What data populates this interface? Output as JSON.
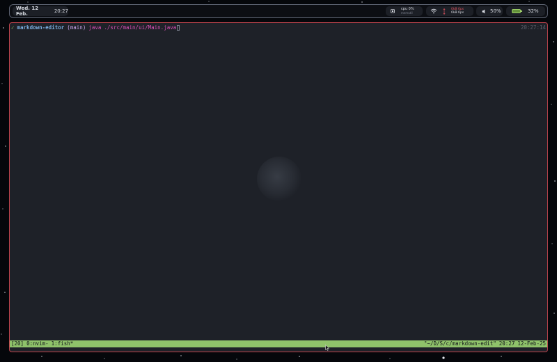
{
  "topbar": {
    "date": "Wed. 12 Feb.",
    "time": "20:27",
    "cpu_label": "cpu 0%",
    "cpu_sub": "memutil",
    "net_up": "0kB 0ps",
    "net_down": "0kB 0ps",
    "volume": "50%",
    "battery": "32%",
    "battery_color": "#64923b"
  },
  "terminal": {
    "check": "✓",
    "dir": "markdown-editor",
    "branch": "(main)",
    "cmd": "java",
    "arg": "./src/main/ui/Main.java",
    "right_time": "20:27:14",
    "border_color": "#c0444d"
  },
  "tmux": {
    "session": "[20]",
    "window0": "0:nvim-",
    "window1": "1:fish*",
    "path": "\"~/D/S/c/markdown-edit\"",
    "time": "20:27",
    "date": "12-Feb-25",
    "bar_color": "#8fc26a"
  }
}
